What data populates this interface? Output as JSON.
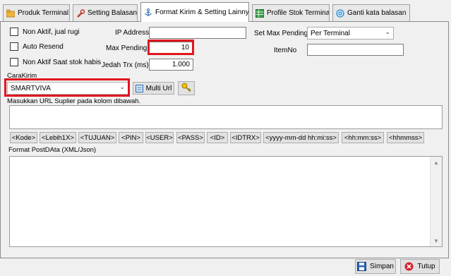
{
  "tabs": [
    {
      "label": "Produk Terminal",
      "icon": "folder-icon",
      "active": false
    },
    {
      "label": "Setting Balasan",
      "icon": "wrench-icon",
      "active": false
    },
    {
      "label": "Format Kirim & Setting Lainnya",
      "icon": "anchor-icon",
      "active": true
    },
    {
      "label": "Profile Stok Terminal",
      "icon": "spreadsheet-icon",
      "active": false
    },
    {
      "label": "Ganti kata balasan",
      "icon": "refresh-circle-icon",
      "active": false
    }
  ],
  "checkboxes": {
    "non_aktif_jual_rugi": "Non Aktif, jual rugi",
    "auto_resend": "Auto Resend",
    "non_aktif_stok_habis": "Non Aktif Saat stok habis"
  },
  "fields": {
    "ip_address_label": "IP Address",
    "ip_address_value": "",
    "max_pending_label": "Max Pending",
    "max_pending_value": "10",
    "jedah_trx_label": "Jedah Trx (ms)",
    "jedah_trx_value": "1.000",
    "set_max_pending_label": "Set Max Pending",
    "set_max_pending_value": "Per Terminal",
    "itemno_label": "ItemNo",
    "itemno_value": ""
  },
  "cara_kirim": {
    "label": "CaraKirim",
    "value": "SMARTVIVA",
    "multi_url_label": "Multi Url"
  },
  "url_section": {
    "label": "Masukkan URL Suplier pada kolom dibawah.",
    "value": ""
  },
  "tags": [
    "<Kode>",
    "<Lebih1X>",
    "<TUJUAN>",
    "<PIN>",
    "<USER>",
    "<PASS>",
    "<ID>",
    "<IDTRX>",
    "<yyyy-mm-dd hh:mi:ss>",
    "<hh:mm:ss>",
    "<hhmmss>"
  ],
  "postdata": {
    "label": "Format PostDAta (XML/Json)",
    "value": ""
  },
  "footer": {
    "save_label": "Simpan",
    "close_label": "Tutup"
  },
  "colors": {
    "highlight": "#e2141e",
    "window_bg": "#f0f0f0"
  }
}
